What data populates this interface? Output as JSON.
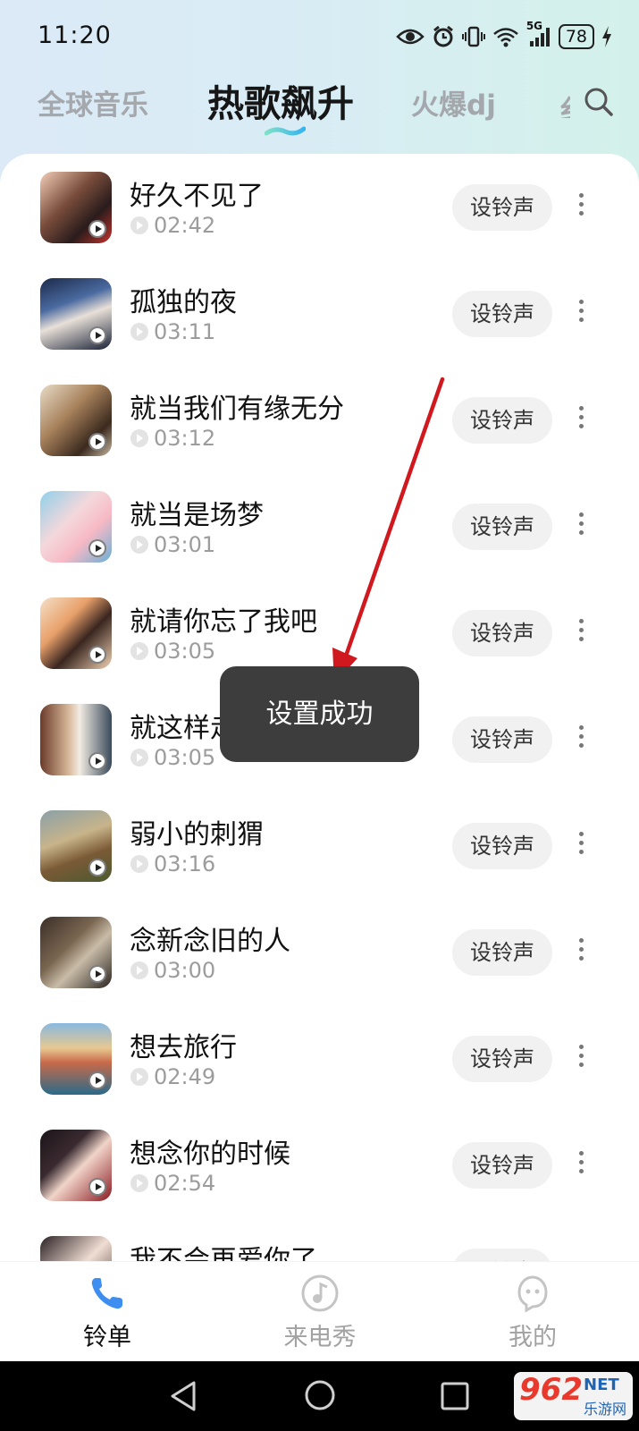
{
  "status_bar": {
    "time": "11:20",
    "network": "5G",
    "battery": "78",
    "icons": [
      "eye-icon",
      "alarm-icon",
      "vibrate-icon",
      "wifi-icon",
      "signal-icon",
      "battery-icon",
      "charging-icon"
    ]
  },
  "tabs": [
    {
      "label": "全球音乐",
      "active": false
    },
    {
      "label": "热歌飙升",
      "active": true
    },
    {
      "label": "火爆dj",
      "active": false
    }
  ],
  "search_icon": "search-icon",
  "ringtones": [
    {
      "title": "好久不见了",
      "duration": "02:42",
      "action": "设铃声"
    },
    {
      "title": "孤独的夜",
      "duration": "03:11",
      "action": "设铃声"
    },
    {
      "title": "就当我们有缘无分",
      "duration": "03:12",
      "action": "设铃声"
    },
    {
      "title": "就当是场梦",
      "duration": "03:01",
      "action": "设铃声"
    },
    {
      "title": "就请你忘了我吧",
      "duration": "03:05",
      "action": "设铃声"
    },
    {
      "title": "就这样走吧",
      "duration": "03:05",
      "action": "设铃声"
    },
    {
      "title": "弱小的刺猬",
      "duration": "03:16",
      "action": "设铃声"
    },
    {
      "title": "念新念旧的人",
      "duration": "03:00",
      "action": "设铃声"
    },
    {
      "title": "想去旅行",
      "duration": "02:49",
      "action": "设铃声"
    },
    {
      "title": "想念你的时候",
      "duration": "02:54",
      "action": "设铃声"
    },
    {
      "title": "我不会再爱你了",
      "duration": "",
      "action": "设铃声"
    }
  ],
  "toast": {
    "message": "设置成功"
  },
  "bottom_nav": [
    {
      "label": "铃单",
      "icon": "phone-icon",
      "active": true
    },
    {
      "label": "来电秀",
      "icon": "music-note-icon",
      "active": false
    },
    {
      "label": "我的",
      "icon": "profile-ghost-icon",
      "active": false
    }
  ],
  "watermark": {
    "text": "962",
    "suffix": "NET",
    "sub": "乐游网"
  },
  "colors": {
    "accent": "#3d8ef0",
    "toast_bg": "#3d3d3d",
    "arrow": "#d0181f"
  }
}
